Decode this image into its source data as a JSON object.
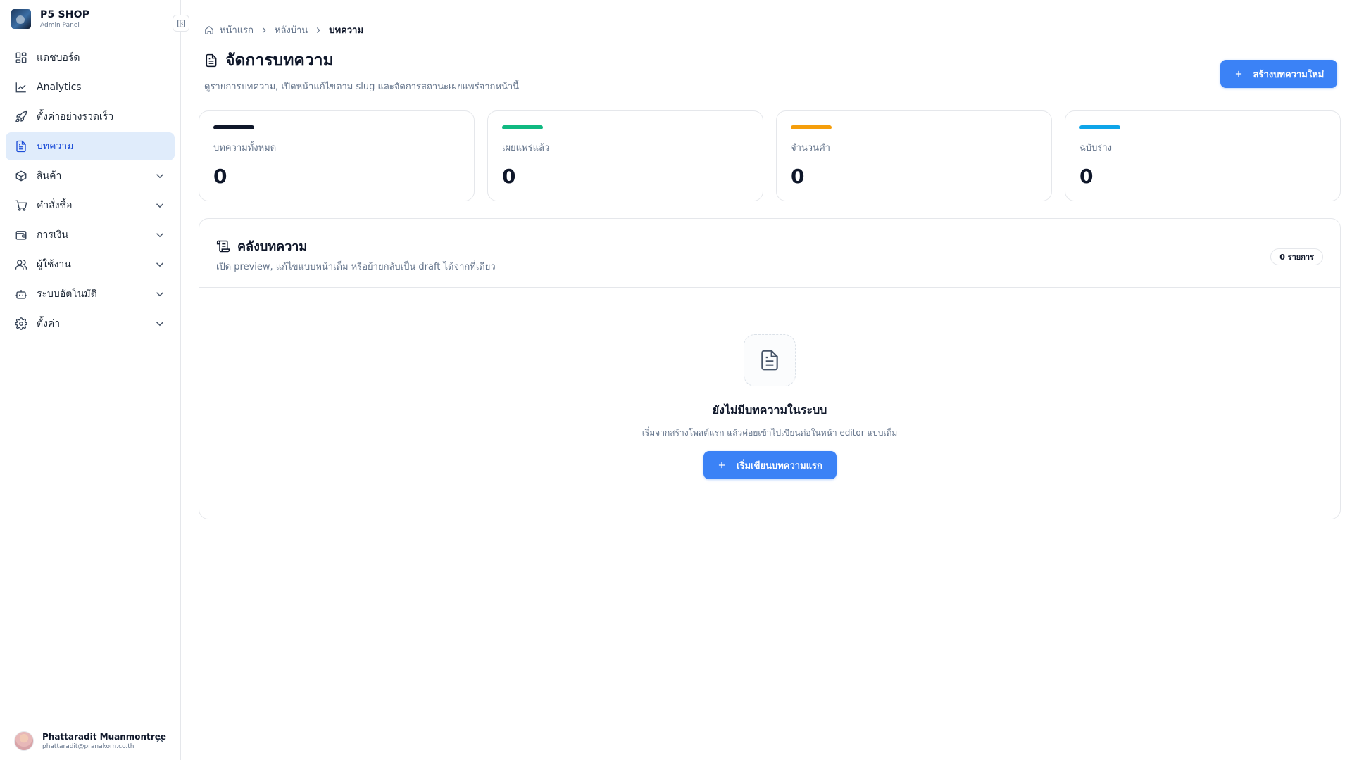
{
  "brand": {
    "title": "P5 SHOP",
    "subtitle": "Admin Panel"
  },
  "sidebar": {
    "items": [
      {
        "label": "แดชบอร์ด",
        "icon": "dashboard-icon"
      },
      {
        "label": "Analytics",
        "icon": "chart-line-icon"
      },
      {
        "label": "ตั้งค่าอย่างรวดเร็ว",
        "icon": "rocket-icon"
      },
      {
        "label": "บทความ",
        "icon": "file-text-icon",
        "active": true
      },
      {
        "label": "สินค้า",
        "icon": "package-icon",
        "expandable": true
      },
      {
        "label": "คำสั่งซื้อ",
        "icon": "cart-icon",
        "expandable": true
      },
      {
        "label": "การเงิน",
        "icon": "wallet-icon",
        "expandable": true
      },
      {
        "label": "ผู้ใช้งาน",
        "icon": "users-icon",
        "expandable": true
      },
      {
        "label": "ระบบอัตโนมัติ",
        "icon": "bot-icon",
        "expandable": true
      },
      {
        "label": "ตั้งค่า",
        "icon": "gear-icon",
        "expandable": true
      }
    ]
  },
  "user": {
    "name": "Phattaradit Muanmontree",
    "email": "phattaradit@pranakorn.co.th"
  },
  "breadcrumb": {
    "home": "หน้าแรก",
    "section": "หลังบ้าน",
    "current": "บทความ"
  },
  "page": {
    "title": "จัดการบทความ",
    "subtitle": "ดูรายการบทความ, เปิดหน้าแก้ไขตาม slug และจัดการสถานะเผยแพร่จากหน้านี้",
    "create_button": "สร้างบทความใหม่"
  },
  "stats": [
    {
      "label": "บทความทั้งหมด",
      "value": "0",
      "color": "#0f172a"
    },
    {
      "label": "เผยแพร่แล้ว",
      "value": "0",
      "color": "#10b981"
    },
    {
      "label": "จำนวนคำ",
      "value": "0",
      "color": "#f59e0b"
    },
    {
      "label": "ฉบับร่าง",
      "value": "0",
      "color": "#0ea5e9"
    }
  ],
  "library": {
    "title": "คลังบทความ",
    "subtitle": "เปิด preview, แก้ไขแบบหน้าเต็ม หรือย้ายกลับเป็น draft ได้จากที่เดียว",
    "count": "0 รายการ",
    "empty_title": "ยังไม่มีบทความในระบบ",
    "empty_subtitle": "เริ่มจากสร้างโพสต์แรก แล้วค่อยเข้าไปเขียนต่อในหน้า editor แบบเต็ม",
    "empty_button": "เริ่มเขียนบทความแรก"
  },
  "colors": {
    "accent": "#3b82f6",
    "active_bg": "#e0ecfb"
  }
}
